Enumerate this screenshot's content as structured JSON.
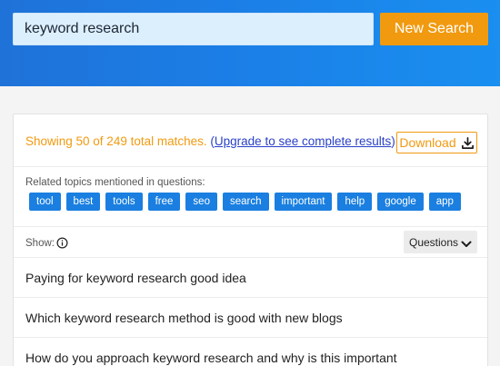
{
  "search": {
    "value": "keyword research",
    "button_label": "New Search"
  },
  "results": {
    "summary": "Showing 50 of 249 total matches.",
    "upgrade_open": "(",
    "upgrade_link": "Upgrade to see complete results",
    "upgrade_close": ")",
    "download_label": "Download",
    "download_icon": "download-icon"
  },
  "topics": {
    "label": "Related topics mentioned in questions:",
    "items": [
      "tool",
      "best",
      "tools",
      "free",
      "seo",
      "search",
      "important",
      "help",
      "google",
      "app"
    ]
  },
  "show": {
    "label": "Show:",
    "info_icon": "info-icon",
    "select_value": "Questions"
  },
  "questions": [
    "Paying for keyword research good idea",
    "Which keyword research method is good with new blogs",
    "How do you approach keyword research and why is this important"
  ],
  "colors": {
    "header_blue": "#1b7ee6",
    "accent_orange": "#f19a10",
    "chip_blue": "#1a7fe0",
    "link_blue": "#2a41c6"
  }
}
